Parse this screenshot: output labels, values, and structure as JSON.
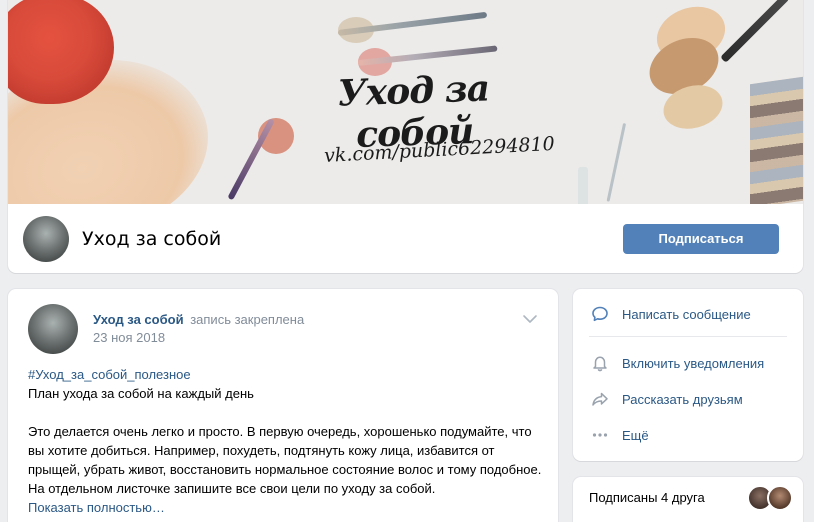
{
  "header": {
    "cover_title": "Уход за собой",
    "cover_url": "vk.com/public62294810",
    "group_name": "Уход за собой",
    "subscribe_label": "Подписаться"
  },
  "post": {
    "author": "Уход за собой",
    "pinned_note": "запись закреплена",
    "date": "23 ноя 2018",
    "hashtag": "#Уход_за_собой_полезное",
    "line1": "План ухода за собой на каждый день",
    "paragraph": "Это делается очень легко и просто. В первую очередь, хорошенько подумайте, что вы хотите добиться. Например, похудеть, подтянуть кожу лица, избавится от прыщей, убрать живот, восстановить нормальное состояние волос и тому подобное. На отдельном листочке запишите все свои цели по уходу за собой.",
    "show_more": "Показать полностью…"
  },
  "actions": {
    "items": [
      {
        "label": "Написать сообщение",
        "icon": "message-icon"
      },
      {
        "label": "Включить уведомления",
        "icon": "bell-icon"
      },
      {
        "label": "Рассказать друзьям",
        "icon": "share-icon"
      },
      {
        "label": "Ещё",
        "icon": "more-dots-icon"
      }
    ]
  },
  "friends": {
    "label": "Подписаны 4 друга"
  },
  "colors": {
    "accent": "#5181b8",
    "link": "#2a5885",
    "muted": "#818c99",
    "background": "#edeef0"
  }
}
